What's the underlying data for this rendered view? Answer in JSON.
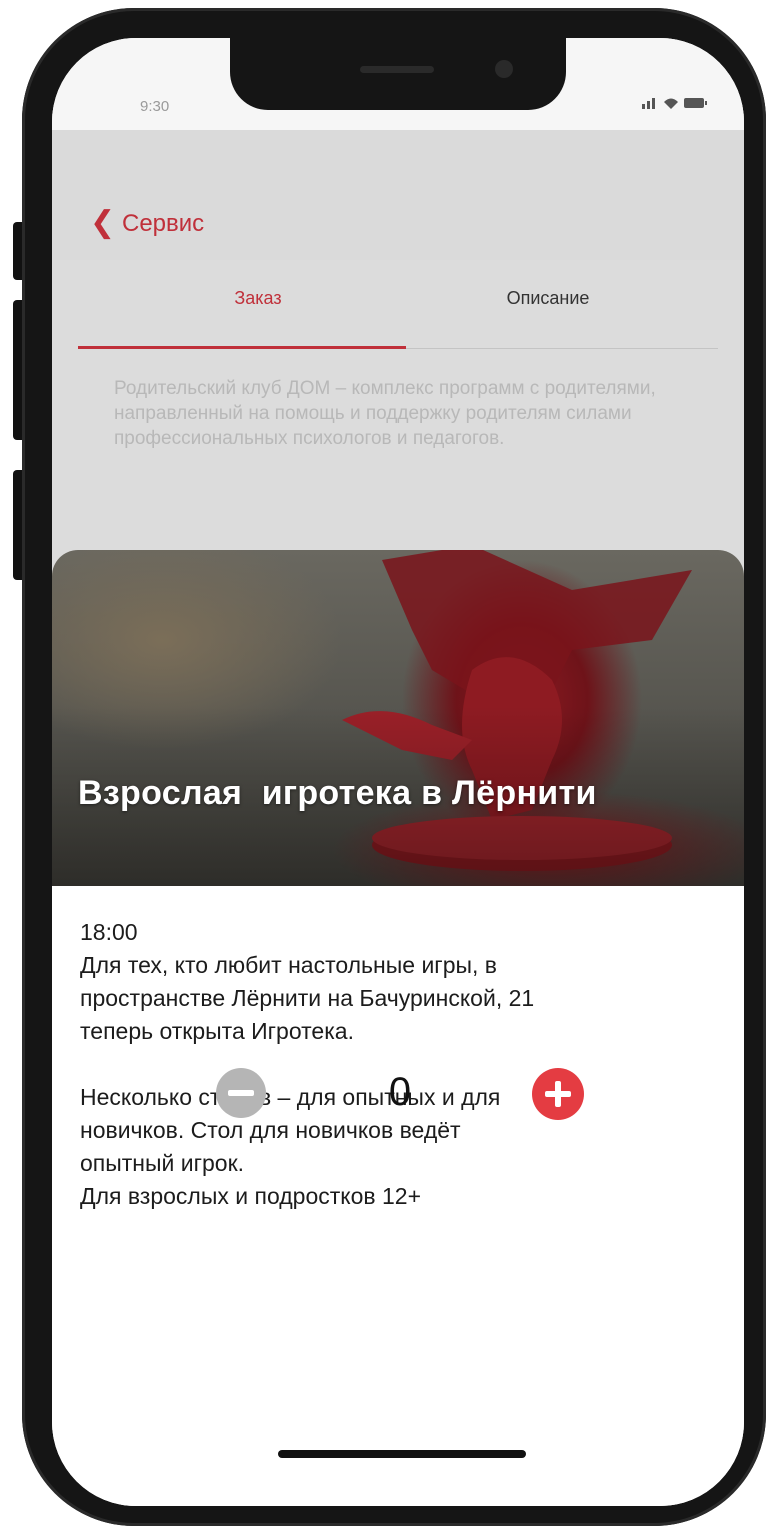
{
  "status_bar": {
    "time": "9:30",
    "icons": [
      "signal-icon",
      "wifi-icon",
      "battery-icon"
    ]
  },
  "nav": {
    "back_label": "Сервис"
  },
  "tabs": [
    {
      "label": "Заказ",
      "active": true
    },
    {
      "label": "Описание",
      "active": false
    }
  ],
  "background_description": "Родительский клуб ДОМ – комплекс программ с родителями, направленный на помощь и поддержку родителям силами профессиональных психологов и педагогов.",
  "event": {
    "title": "Взрослая  игротека в Лёрнити",
    "time": "18:00",
    "paragraph1": [
      "Для тех, кто любит настольные игры, в",
      "пространстве Лёрнити на Бачуринской, 21",
      "теперь открыта Игротека."
    ],
    "paragraph2": [
      "Несколько столов – для опытных и для",
      "новичков. Стол для новичков ведёт",
      "опытный игрок.",
      "Для взрослых и подростков 12+"
    ]
  },
  "counter": {
    "value": "0"
  },
  "colors": {
    "accent": "#c0303a",
    "plus_button": "#e43c42",
    "minus_button": "#b5b5b5"
  }
}
